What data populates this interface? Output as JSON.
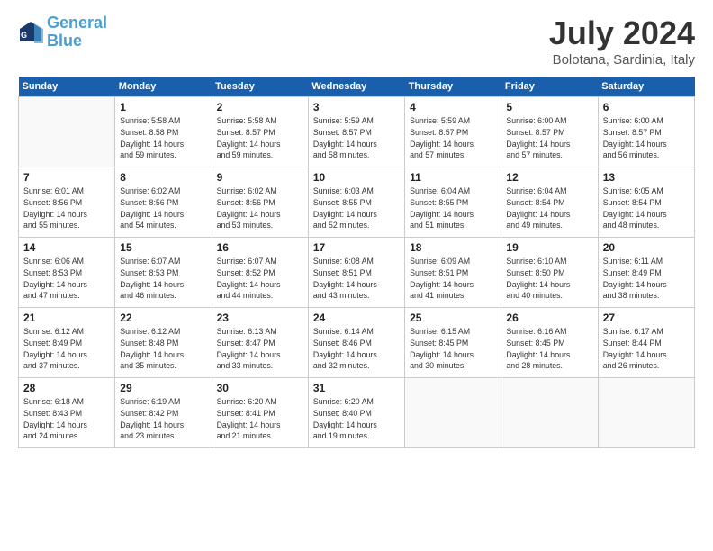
{
  "header": {
    "logo_line1": "General",
    "logo_line2": "Blue",
    "month_year": "July 2024",
    "location": "Bolotana, Sardinia, Italy"
  },
  "days_of_week": [
    "Sunday",
    "Monday",
    "Tuesday",
    "Wednesday",
    "Thursday",
    "Friday",
    "Saturday"
  ],
  "weeks": [
    [
      {
        "num": "",
        "info": ""
      },
      {
        "num": "1",
        "info": "Sunrise: 5:58 AM\nSunset: 8:58 PM\nDaylight: 14 hours\nand 59 minutes."
      },
      {
        "num": "2",
        "info": "Sunrise: 5:58 AM\nSunset: 8:57 PM\nDaylight: 14 hours\nand 59 minutes."
      },
      {
        "num": "3",
        "info": "Sunrise: 5:59 AM\nSunset: 8:57 PM\nDaylight: 14 hours\nand 58 minutes."
      },
      {
        "num": "4",
        "info": "Sunrise: 5:59 AM\nSunset: 8:57 PM\nDaylight: 14 hours\nand 57 minutes."
      },
      {
        "num": "5",
        "info": "Sunrise: 6:00 AM\nSunset: 8:57 PM\nDaylight: 14 hours\nand 57 minutes."
      },
      {
        "num": "6",
        "info": "Sunrise: 6:00 AM\nSunset: 8:57 PM\nDaylight: 14 hours\nand 56 minutes."
      }
    ],
    [
      {
        "num": "7",
        "info": "Sunrise: 6:01 AM\nSunset: 8:56 PM\nDaylight: 14 hours\nand 55 minutes."
      },
      {
        "num": "8",
        "info": "Sunrise: 6:02 AM\nSunset: 8:56 PM\nDaylight: 14 hours\nand 54 minutes."
      },
      {
        "num": "9",
        "info": "Sunrise: 6:02 AM\nSunset: 8:56 PM\nDaylight: 14 hours\nand 53 minutes."
      },
      {
        "num": "10",
        "info": "Sunrise: 6:03 AM\nSunset: 8:55 PM\nDaylight: 14 hours\nand 52 minutes."
      },
      {
        "num": "11",
        "info": "Sunrise: 6:04 AM\nSunset: 8:55 PM\nDaylight: 14 hours\nand 51 minutes."
      },
      {
        "num": "12",
        "info": "Sunrise: 6:04 AM\nSunset: 8:54 PM\nDaylight: 14 hours\nand 49 minutes."
      },
      {
        "num": "13",
        "info": "Sunrise: 6:05 AM\nSunset: 8:54 PM\nDaylight: 14 hours\nand 48 minutes."
      }
    ],
    [
      {
        "num": "14",
        "info": "Sunrise: 6:06 AM\nSunset: 8:53 PM\nDaylight: 14 hours\nand 47 minutes."
      },
      {
        "num": "15",
        "info": "Sunrise: 6:07 AM\nSunset: 8:53 PM\nDaylight: 14 hours\nand 46 minutes."
      },
      {
        "num": "16",
        "info": "Sunrise: 6:07 AM\nSunset: 8:52 PM\nDaylight: 14 hours\nand 44 minutes."
      },
      {
        "num": "17",
        "info": "Sunrise: 6:08 AM\nSunset: 8:51 PM\nDaylight: 14 hours\nand 43 minutes."
      },
      {
        "num": "18",
        "info": "Sunrise: 6:09 AM\nSunset: 8:51 PM\nDaylight: 14 hours\nand 41 minutes."
      },
      {
        "num": "19",
        "info": "Sunrise: 6:10 AM\nSunset: 8:50 PM\nDaylight: 14 hours\nand 40 minutes."
      },
      {
        "num": "20",
        "info": "Sunrise: 6:11 AM\nSunset: 8:49 PM\nDaylight: 14 hours\nand 38 minutes."
      }
    ],
    [
      {
        "num": "21",
        "info": "Sunrise: 6:12 AM\nSunset: 8:49 PM\nDaylight: 14 hours\nand 37 minutes."
      },
      {
        "num": "22",
        "info": "Sunrise: 6:12 AM\nSunset: 8:48 PM\nDaylight: 14 hours\nand 35 minutes."
      },
      {
        "num": "23",
        "info": "Sunrise: 6:13 AM\nSunset: 8:47 PM\nDaylight: 14 hours\nand 33 minutes."
      },
      {
        "num": "24",
        "info": "Sunrise: 6:14 AM\nSunset: 8:46 PM\nDaylight: 14 hours\nand 32 minutes."
      },
      {
        "num": "25",
        "info": "Sunrise: 6:15 AM\nSunset: 8:45 PM\nDaylight: 14 hours\nand 30 minutes."
      },
      {
        "num": "26",
        "info": "Sunrise: 6:16 AM\nSunset: 8:45 PM\nDaylight: 14 hours\nand 28 minutes."
      },
      {
        "num": "27",
        "info": "Sunrise: 6:17 AM\nSunset: 8:44 PM\nDaylight: 14 hours\nand 26 minutes."
      }
    ],
    [
      {
        "num": "28",
        "info": "Sunrise: 6:18 AM\nSunset: 8:43 PM\nDaylight: 14 hours\nand 24 minutes."
      },
      {
        "num": "29",
        "info": "Sunrise: 6:19 AM\nSunset: 8:42 PM\nDaylight: 14 hours\nand 23 minutes."
      },
      {
        "num": "30",
        "info": "Sunrise: 6:20 AM\nSunset: 8:41 PM\nDaylight: 14 hours\nand 21 minutes."
      },
      {
        "num": "31",
        "info": "Sunrise: 6:20 AM\nSunset: 8:40 PM\nDaylight: 14 hours\nand 19 minutes."
      },
      {
        "num": "",
        "info": ""
      },
      {
        "num": "",
        "info": ""
      },
      {
        "num": "",
        "info": ""
      }
    ]
  ]
}
